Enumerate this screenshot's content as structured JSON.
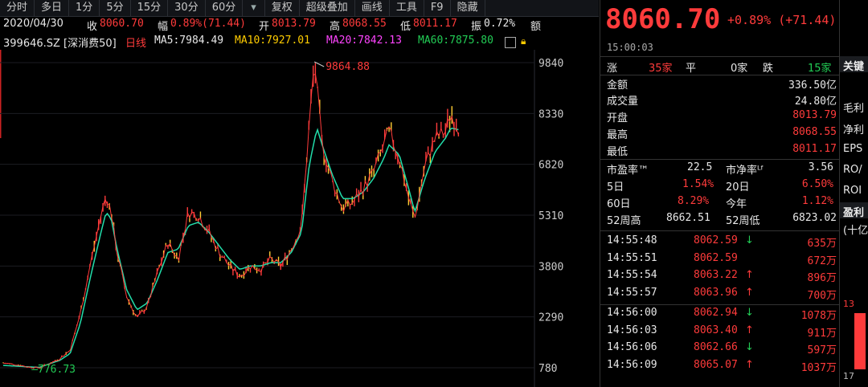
{
  "toolbar": {
    "items": [
      "分时",
      "多日",
      "1分",
      "5分",
      "15分",
      "30分",
      "60分",
      "▾",
      "复权",
      "超级叠加",
      "画线",
      "工具",
      "F9",
      "隐藏"
    ]
  },
  "info1": {
    "date": "2020/04/30",
    "close_label": "收",
    "close": "8060.70",
    "change_label": "幅",
    "change": "0.89%(71.44)",
    "open_label": "开",
    "open": "8013.79",
    "high_label": "高",
    "high": "8068.55",
    "low_label": "低",
    "low": "8011.17",
    "amp_label": "振",
    "amp": "0.72%",
    "amount_label": "额"
  },
  "info2": {
    "code": "399646.SZ [深消费50]",
    "period": "日线",
    "ma5": "MA5:7984.49",
    "ma10": "MA10:7927.01",
    "ma20": "MA20:7842.13",
    "ma60": "MA60:7875.80"
  },
  "chart_data": {
    "type": "line",
    "series": [
      {
        "name": "MA5",
        "color": "#ffffff"
      },
      {
        "name": "MA10",
        "color": "#ffcc00"
      },
      {
        "name": "MA20",
        "color": "#ff44ff"
      },
      {
        "name": "MA60",
        "color": "#22cc55"
      }
    ],
    "ylim": [
      780,
      9840
    ],
    "yticks": [
      "9840",
      "8330",
      "6820",
      "5310",
      "3800",
      "2290",
      "780"
    ],
    "ytick_values": [
      9840,
      8330,
      6820,
      5310,
      3800,
      2290,
      780
    ],
    "annotations": {
      "max": "9864.88",
      "min": "776.73"
    },
    "price": [
      [
        0,
        920
      ],
      [
        0.03,
        860
      ],
      [
        0.05,
        800
      ],
      [
        0.07,
        777
      ],
      [
        0.09,
        900
      ],
      [
        0.11,
        1050
      ],
      [
        0.13,
        1300
      ],
      [
        0.15,
        2400
      ],
      [
        0.17,
        3900
      ],
      [
        0.19,
        5300
      ],
      [
        0.2,
        5900
      ],
      [
        0.21,
        5400
      ],
      [
        0.22,
        4300
      ],
      [
        0.24,
        2900
      ],
      [
        0.26,
        2250
      ],
      [
        0.28,
        2600
      ],
      [
        0.3,
        3600
      ],
      [
        0.32,
        4500
      ],
      [
        0.34,
        4000
      ],
      [
        0.36,
        5400
      ],
      [
        0.38,
        5300
      ],
      [
        0.4,
        4800
      ],
      [
        0.42,
        4200
      ],
      [
        0.44,
        3800
      ],
      [
        0.46,
        3500
      ],
      [
        0.48,
        3800
      ],
      [
        0.5,
        3700
      ],
      [
        0.52,
        4000
      ],
      [
        0.54,
        3800
      ],
      [
        0.56,
        4300
      ],
      [
        0.58,
        5000
      ],
      [
        0.595,
        8000
      ],
      [
        0.605,
        9864
      ],
      [
        0.62,
        7400
      ],
      [
        0.64,
        6300
      ],
      [
        0.66,
        5500
      ],
      [
        0.68,
        5700
      ],
      [
        0.7,
        6100
      ],
      [
        0.72,
        6600
      ],
      [
        0.74,
        7400
      ],
      [
        0.75,
        7800
      ],
      [
        0.77,
        7000
      ],
      [
        0.79,
        5700
      ],
      [
        0.8,
        5200
      ],
      [
        0.82,
        6800
      ],
      [
        0.84,
        7600
      ],
      [
        0.86,
        7800
      ],
      [
        0.87,
        8330
      ],
      [
        0.885,
        7900
      ]
    ],
    "ma": [
      [
        0,
        850
      ],
      [
        0.07,
        790
      ],
      [
        0.11,
        1000
      ],
      [
        0.13,
        1200
      ],
      [
        0.15,
        2100
      ],
      [
        0.17,
        3500
      ],
      [
        0.19,
        4800
      ],
      [
        0.2,
        5400
      ],
      [
        0.21,
        5200
      ],
      [
        0.22,
        4400
      ],
      [
        0.24,
        3100
      ],
      [
        0.26,
        2500
      ],
      [
        0.28,
        2700
      ],
      [
        0.3,
        3400
      ],
      [
        0.32,
        4200
      ],
      [
        0.34,
        4300
      ],
      [
        0.36,
        5000
      ],
      [
        0.38,
        5100
      ],
      [
        0.4,
        4800
      ],
      [
        0.42,
        4400
      ],
      [
        0.44,
        4000
      ],
      [
        0.46,
        3700
      ],
      [
        0.48,
        3800
      ],
      [
        0.5,
        3800
      ],
      [
        0.52,
        3900
      ],
      [
        0.54,
        3900
      ],
      [
        0.56,
        4200
      ],
      [
        0.58,
        4800
      ],
      [
        0.595,
        6800
      ],
      [
        0.61,
        7900
      ],
      [
        0.62,
        7400
      ],
      [
        0.64,
        6500
      ],
      [
        0.66,
        5800
      ],
      [
        0.68,
        5800
      ],
      [
        0.7,
        6000
      ],
      [
        0.72,
        6400
      ],
      [
        0.74,
        7000
      ],
      [
        0.75,
        7400
      ],
      [
        0.77,
        7100
      ],
      [
        0.79,
        6000
      ],
      [
        0.8,
        5400
      ],
      [
        0.82,
        6400
      ],
      [
        0.84,
        7200
      ],
      [
        0.86,
        7600
      ],
      [
        0.87,
        7900
      ],
      [
        0.885,
        7850
      ]
    ]
  },
  "quote": {
    "price": "8060.70",
    "change": "+0.89% (+71.44)",
    "time": "15:00:03",
    "breadth": {
      "up_label": "涨",
      "up": "35家",
      "flat_label": "平",
      "flat": "0家",
      "down_label": "跌",
      "down": "15家"
    },
    "amount": {
      "label": "金额",
      "value": "336.50亿"
    },
    "volume": {
      "label": "成交量",
      "value": "24.80亿"
    },
    "open": {
      "label": "开盘",
      "value": "8013.79"
    },
    "high": {
      "label": "最高",
      "value": "8068.55"
    },
    "low": {
      "label": "最低",
      "value": "8011.17"
    },
    "pe": {
      "label": "市盈率™",
      "value": "22.5"
    },
    "pb": {
      "label": "市净率ᴸᶠ",
      "value": "3.56"
    },
    "d5": {
      "label": "5日",
      "value": "1.54%"
    },
    "d20": {
      "label": "20日",
      "value": "6.50%"
    },
    "d60": {
      "label": "60日",
      "value": "8.29%"
    },
    "ytd": {
      "label": "今年",
      "value": "1.12%"
    },
    "w52h": {
      "label": "52周高",
      "value": "8662.51"
    },
    "w52l": {
      "label": "52周低",
      "value": "6823.02"
    }
  },
  "ticks": [
    {
      "time": "14:55:48",
      "price": "8062.59",
      "dir": "down",
      "vol": "635万"
    },
    {
      "time": "14:55:51",
      "price": "8062.59",
      "dir": "",
      "vol": "672万"
    },
    {
      "time": "14:55:54",
      "price": "8063.22",
      "dir": "up",
      "vol": "896万"
    },
    {
      "time": "14:55:57",
      "price": "8063.96",
      "dir": "up",
      "vol": "700万"
    },
    {
      "time": "14:56:00",
      "price": "8062.94",
      "dir": "down",
      "vol": "1078万"
    },
    {
      "time": "14:56:03",
      "price": "8063.40",
      "dir": "up",
      "vol": "911万"
    },
    {
      "time": "14:56:06",
      "price": "8062.66",
      "dir": "down",
      "vol": "597万"
    },
    {
      "time": "14:56:09",
      "price": "8065.07",
      "dir": "up",
      "vol": "1037万"
    }
  ],
  "far_panel": {
    "title": "关键",
    "items": [
      "毛利",
      "净利",
      "EPS",
      "RO/",
      "ROI"
    ],
    "section": "盈利",
    "sub": "(十亿",
    "num1": "13",
    "num2": "17"
  }
}
